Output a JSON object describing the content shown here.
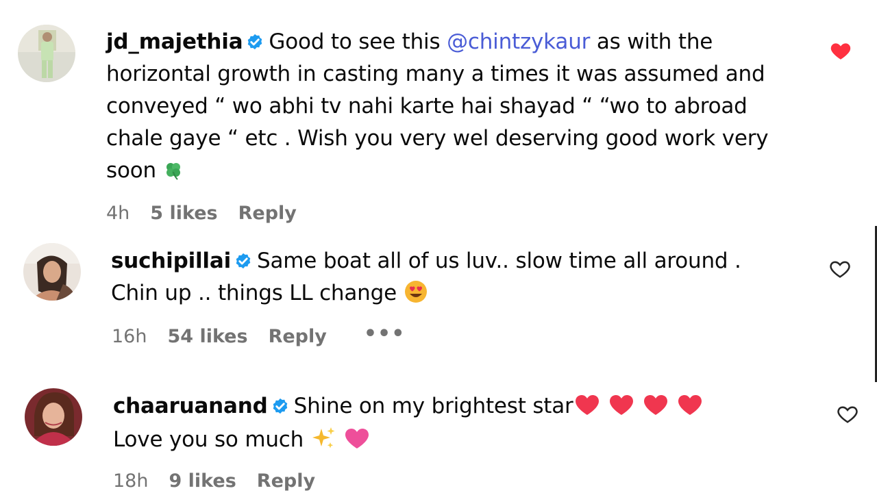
{
  "comments": [
    {
      "username": "jd_majethia",
      "text_before": "Good to see this ",
      "mention": "@chintzykaur",
      "text_after": " as with the horizontal growth in casting many a times it was assumed and conveyed “ wo abhi tv nahi karte hai shayad “ “wo to abroad chale gaye “ etc . Wish you very wel deserving good work very soon ",
      "emoji_icons": [
        "four-leaf-clover-icon"
      ],
      "time": "4h",
      "likes": "5 likes",
      "reply": "Reply",
      "liked": true,
      "like_color": "#ff3040"
    },
    {
      "username": "suchipillai",
      "text": "Same boat all of us luv.. slow time all around . Chin up .. things LL change ",
      "emoji_icons": [
        "heart-eyes-icon"
      ],
      "time": "16h",
      "likes": "54 likes",
      "reply": "Reply",
      "more": "•••",
      "liked": false
    },
    {
      "username": "chaaruanand",
      "text_line1": "Shine on my brightest star",
      "text_line2": "Love you so much ",
      "emoji_icons": [
        "red-heart-icon",
        "red-heart-icon",
        "red-heart-icon",
        "red-heart-icon",
        "sparkles-icon",
        "pink-heart-icon"
      ],
      "time": "18h",
      "likes": "9 likes",
      "reply": "Reply",
      "liked": false
    }
  ],
  "colors": {
    "verified": "#1d9bf0",
    "mention": "#4a5cd6",
    "meta": "#737373",
    "liked": "#ff3040"
  }
}
